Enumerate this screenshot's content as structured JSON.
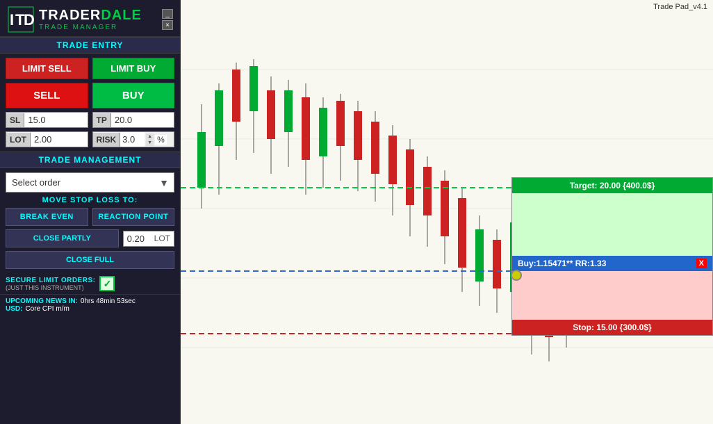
{
  "appTitle": "Trade Pad_v4.1",
  "windowControls": {
    "minimize": "_",
    "close": "×"
  },
  "logo": {
    "name": "TRADERDALE",
    "subtitle": "TRADE MANAGER",
    "icon": "TD"
  },
  "tradeEntry": {
    "sectionLabel": "TRADE ENTRY",
    "limitSell": "LIMIT SELL",
    "limitBuy": "LIMIT BUY",
    "sell": "SELL",
    "buy": "BUY",
    "slLabel": "SL",
    "slValue": "15.0",
    "tpLabel": "TP",
    "tpValue": "20.0",
    "lotLabel": "LOT",
    "lotValue": "2.00",
    "riskLabel": "RISK",
    "riskValue": "3.0",
    "riskUnit": "%"
  },
  "tradeManagement": {
    "sectionLabel": "TRADE MANAGEMENT",
    "selectOrderPlaceholder": "Select order",
    "moveStopLabel": "MOVE STOP LOSS TO:",
    "breakEven": "BREAK EVEN",
    "reactionPoint": "REACTION POINT",
    "closePartly": "CLOSE PARTLY",
    "lotValue": "0.20",
    "lotLabel": "LOT",
    "closeFull": "CLOSE FULL"
  },
  "secureLimitOrders": {
    "label": "SECURE LIMIT ORDERS:",
    "sublabel": "(JUST THIS INSTRUMENT)",
    "checked": true
  },
  "upcomingNews": {
    "label": "UPCOMING NEWS IN:",
    "time": "0hrs 48min 53sec",
    "currency": "USD:",
    "description": "Core CPI m/m"
  },
  "tradeBox": {
    "targetLabel": "Target: 20.00 {400.0$}",
    "entryLabel": "Buy:1.15471** RR:1.33",
    "stopLabel": "Stop: 15.00 {300.0$}",
    "closeBtn": "X"
  },
  "chartLines": {
    "greenLineY": 270,
    "blueLineY": 390,
    "redLineY": 480
  }
}
